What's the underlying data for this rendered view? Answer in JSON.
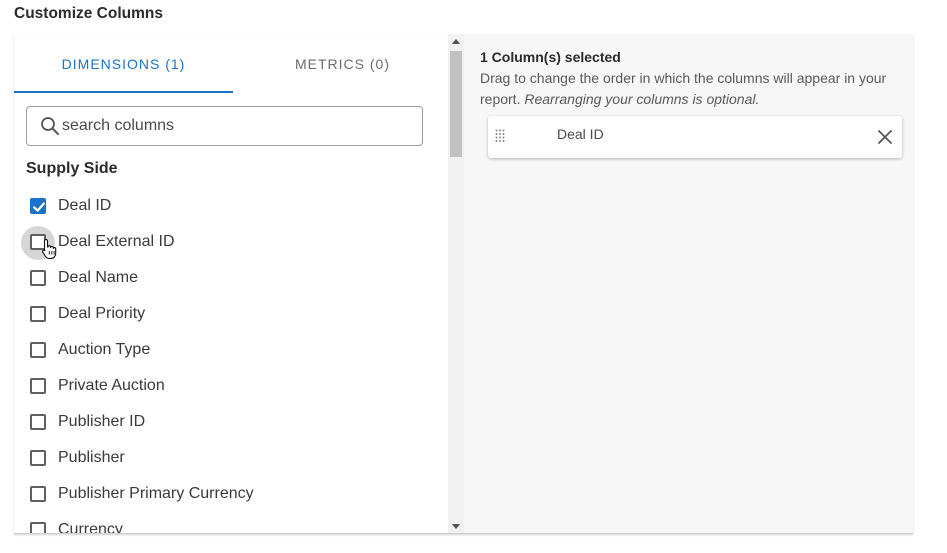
{
  "page": {
    "title": "Customize Columns"
  },
  "tabs": [
    {
      "label": "DIMENSIONS (1)",
      "active": true
    },
    {
      "label": "METRICS (0)",
      "active": false
    }
  ],
  "search": {
    "placeholder": "search columns",
    "value": ""
  },
  "section": {
    "title": "Supply Side"
  },
  "options": [
    {
      "label": "Deal ID",
      "checked": true
    },
    {
      "label": "Deal External ID",
      "checked": false,
      "hovered": true
    },
    {
      "label": "Deal Name",
      "checked": false
    },
    {
      "label": "Deal Priority",
      "checked": false
    },
    {
      "label": "Auction Type",
      "checked": false
    },
    {
      "label": "Private Auction",
      "checked": false
    },
    {
      "label": "Publisher ID",
      "checked": false
    },
    {
      "label": "Publisher",
      "checked": false
    },
    {
      "label": "Publisher Primary Currency",
      "checked": false
    },
    {
      "label": "Currency",
      "checked": false
    }
  ],
  "selected": {
    "count_label": "1 Column(s) selected",
    "help_text": "Drag to change the order in which the columns will appear in your report.",
    "help_optional": "Rearranging your columns is optional.",
    "columns": [
      {
        "label": "Deal ID"
      }
    ]
  },
  "colors": {
    "accent": "#1a73c8",
    "right_panel_bg": "#f7f7f7",
    "scroll_thumb": "#c1c1c1"
  },
  "icons": {
    "search": "search-icon",
    "drag": "drag-handle-icon",
    "remove": "close-icon",
    "cursor": "hand-pointer-icon"
  }
}
